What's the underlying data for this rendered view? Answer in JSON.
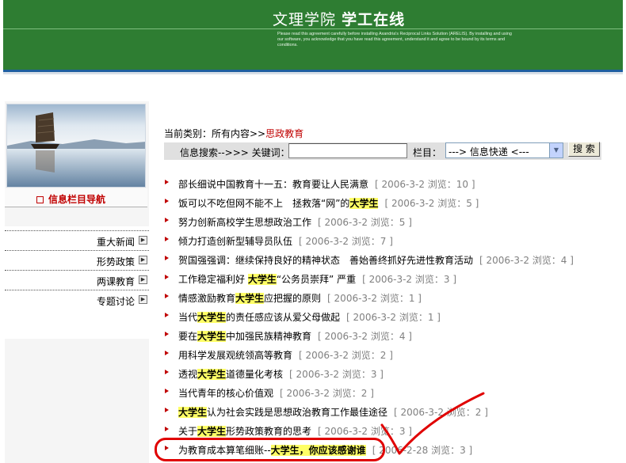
{
  "header": {
    "title_part1": "文理学院",
    "title_part2": "学工在线",
    "fine_print": "Please read this agreement carefully before installing Axandria's Reciprocal Links Solution (ARELIS). By installing and using our software, you acknowledge that you have read this agreement, understand it and agree to be bound by its terms and conditions."
  },
  "sidebar": {
    "nav_title": "信息栏目导航",
    "items": [
      {
        "label": "重大新闻"
      },
      {
        "label": "形势政策"
      },
      {
        "label": "两课教育"
      },
      {
        "label": "专题讨论"
      }
    ]
  },
  "breadcrumb": {
    "prefix": "当前类别：所有内容>>",
    "current": "思政教育"
  },
  "search": {
    "label": "信息搜索-->>> 关键词：",
    "keyword_value": "",
    "column_label": "栏目：",
    "column_value": "---> 信息快递 <---",
    "button_label": "搜 索"
  },
  "articles": [
    {
      "pre": "部长细说中国教育十一五：教育要让人民满意",
      "hl": "",
      "post": "",
      "meta": "[ 2006-3-2  浏览：10 ]"
    },
    {
      "pre": "饭可以不吃但网不能不上　拯救落“网”的",
      "hl": "大学生",
      "post": "",
      "meta": "[ 2006-3-2  浏览：5 ]"
    },
    {
      "pre": "努力创新高校学生思想政治工作",
      "hl": "",
      "post": "",
      "meta": "[ 2006-3-2  浏览：5 ]"
    },
    {
      "pre": "倾力打造创新型辅导员队伍",
      "hl": "",
      "post": "",
      "meta": "[ 2006-3-2  浏览：7 ]"
    },
    {
      "pre": "贺国强强调：继续保持良好的精神状态　善始善终抓好先进性教育活动",
      "hl": "",
      "post": "",
      "meta": "[ 2006-3-2  浏览：4 ]"
    },
    {
      "pre": "工作稳定福利好 ",
      "hl": "大学生",
      "post": "“公务员崇拜” 严重",
      "meta": "[ 2006-3-2  浏览：3 ]"
    },
    {
      "pre": "情感激励教育",
      "hl": "大学生",
      "post": "应把握的原则",
      "meta": "[ 2006-3-2  浏览：1 ]"
    },
    {
      "pre": "当代",
      "hl": "大学生",
      "post": "的责任感应该从爱父母做起",
      "meta": "[ 2006-3-2  浏览：1 ]"
    },
    {
      "pre": "要在",
      "hl": "大学生",
      "post": "中加强民族精神教育",
      "meta": "[ 2006-3-2  浏览：4 ]"
    },
    {
      "pre": "用科学发展观统领高等教育",
      "hl": "",
      "post": "",
      "meta": "[ 2006-3-2  浏览：2 ]"
    },
    {
      "pre": "透视",
      "hl": "大学生",
      "post": "道德量化考核",
      "meta": "[ 2006-3-2  浏览：3 ]"
    },
    {
      "pre": "当代青年的核心价值观",
      "hl": "",
      "post": "",
      "meta": "[ 2006-3-2  浏览：2 ]"
    },
    {
      "pre": "",
      "hl": "大学生",
      "post": "认为社会实践是思想政治教育工作最佳途径",
      "meta": "[ 2006-3-2  浏览：2 ]"
    },
    {
      "pre": "关于",
      "hl": "大学生",
      "post": "形势政策教育的思考",
      "meta": "[ 2006-3-2  浏览：3 ]"
    },
    {
      "pre": "为教育成本算笔细账--",
      "hl": "大学生，你应该感谢谁",
      "post": "",
      "meta": "[ 2006-2-28  浏览：3 ]"
    }
  ],
  "colors": {
    "header_green": "#2e7d32",
    "accent_red": "#c00000",
    "highlight_yellow": "#ffff66",
    "annotation_red": "#e00000"
  }
}
